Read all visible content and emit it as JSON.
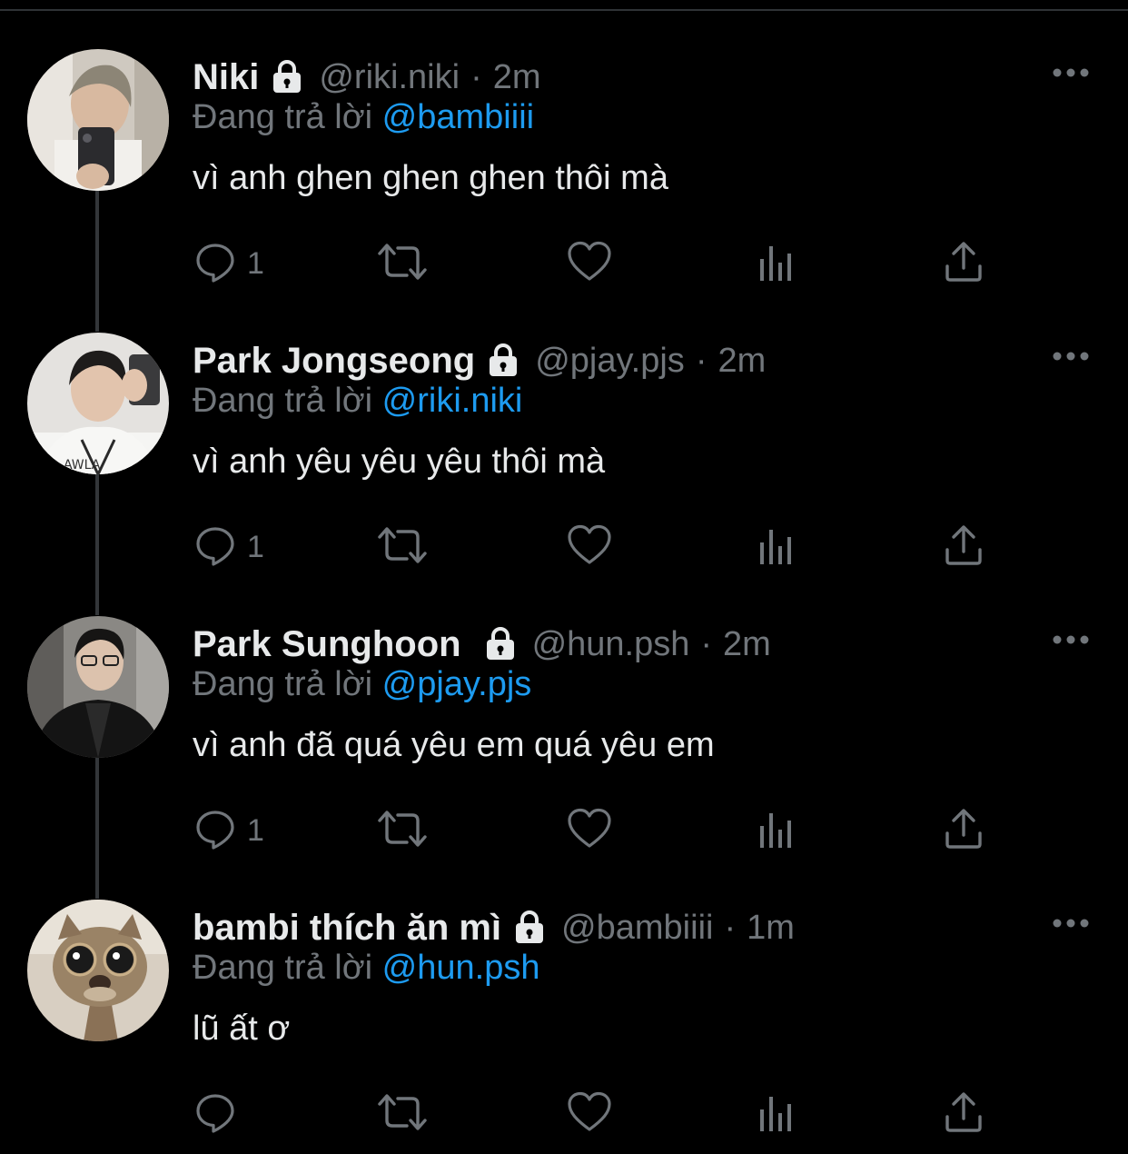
{
  "theme": {
    "background": "#000000",
    "text_primary": "#e7e9ea",
    "text_secondary": "#71767b",
    "accent": "#1d9bf0",
    "thread_line": "#333639"
  },
  "icons": {
    "lock": "lock-icon",
    "more": "more-horizontal-icon",
    "reply": "reply-bubble-icon",
    "retweet": "retweet-icon",
    "like": "heart-icon",
    "views": "analytics-bars-icon",
    "share": "share-upload-icon"
  },
  "tweets": [
    {
      "display_name": "Niki",
      "handle": "@riki.niki",
      "separator": "·",
      "time": "2m",
      "reply_prefix": "Đang trả lời",
      "reply_to": "@bambiiii",
      "text": "vì anh ghen ghen ghen thôi mà",
      "reply_count": "1",
      "avatar_desc": "mirror-selfie"
    },
    {
      "display_name": "Park Jongseong",
      "handle": "@pjay.pjs",
      "separator": "·",
      "time": "2m",
      "reply_prefix": "Đang trả lời",
      "reply_to": "@riki.niki",
      "text": "vì anh yêu yêu yêu thôi mà",
      "reply_count": "1",
      "avatar_desc": "mirror-selfie"
    },
    {
      "display_name": "Park Sunghoon",
      "handle": "@hun.psh",
      "separator": "·",
      "time": "2m",
      "reply_prefix": "Đang trả lời",
      "reply_to": "@pjay.pjs",
      "text": "vì anh đã quá yêu em quá yêu em",
      "reply_count": "1",
      "avatar_desc": "leather-jacket-portrait"
    },
    {
      "display_name": "bambi thích ăn mì",
      "handle": "@bambiiii",
      "separator": "·",
      "time": "1m",
      "reply_prefix": "Đang trả lời",
      "reply_to": "@hun.psh",
      "text": "lũ ất ơ",
      "reply_count": "",
      "avatar_desc": "cat-closeup"
    }
  ]
}
